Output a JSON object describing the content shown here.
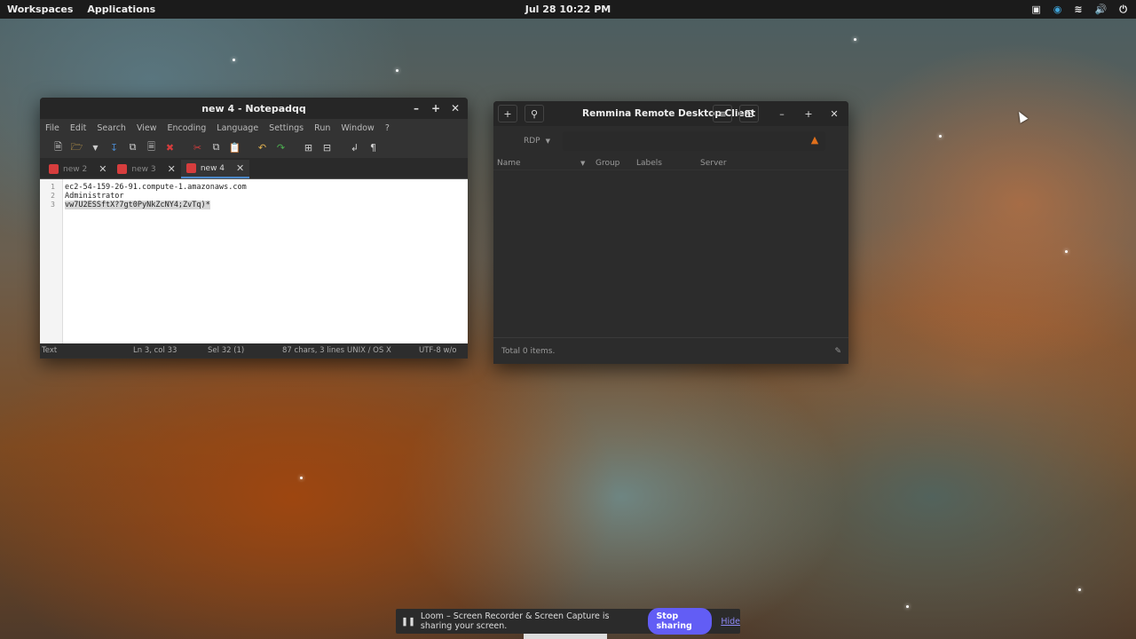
{
  "topbar": {
    "workspaces": "Workspaces",
    "applications": "Applications",
    "clock": "Jul 28  10:22 PM",
    "tray_icons": [
      "display-icon",
      "app-indicator-icon",
      "wifi-icon",
      "volume-icon",
      "power-icon"
    ]
  },
  "notepadqq": {
    "title": "new 4 - Notepadqq",
    "menu": [
      "File",
      "Edit",
      "Search",
      "View",
      "Encoding",
      "Language",
      "Settings",
      "Run",
      "Window",
      "?"
    ],
    "tabs": [
      {
        "label": "new 2",
        "active": false
      },
      {
        "label": "new 3",
        "active": false
      },
      {
        "label": "new 4",
        "active": true
      }
    ],
    "line_numbers": [
      "1",
      "2",
      "3"
    ],
    "lines": [
      "ec2-54-159-26-91.compute-1.amazonaws.com",
      "Administrator",
      "vw7U2ESSftX?7gt0PyNkZcNY4;ZvTq)*"
    ],
    "status": {
      "language": "Text",
      "position": "Ln 3, col 33",
      "selection": "Sel 32 (1)",
      "counts": "87 chars, 3 lines",
      "eol": "UNIX / OS X",
      "encoding": "UTF-8 w/o"
    }
  },
  "remmina": {
    "title": "Remmina Remote Desktop Client",
    "protocol": "RDP",
    "columns": [
      "Name",
      "Group",
      "Labels",
      "Server"
    ],
    "footer": "Total 0 items."
  },
  "loom": {
    "message": "Loom – Screen Recorder & Screen Capture is sharing your screen.",
    "stop_label": "Stop sharing",
    "hide_label": "Hide"
  },
  "colors": {
    "loom_accent": "#625df5",
    "tab_active_underline": "#4a86c7",
    "connect_icon": "#e0701c"
  }
}
